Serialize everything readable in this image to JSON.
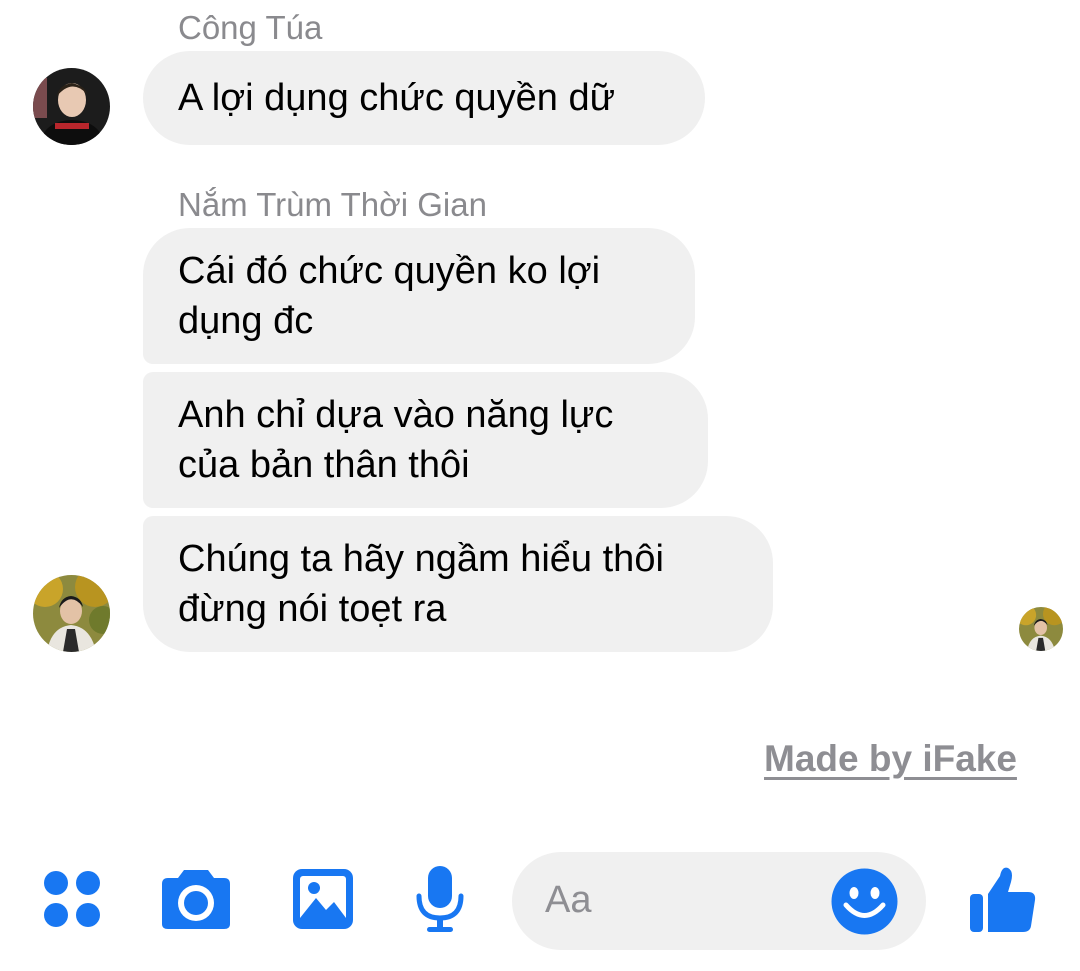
{
  "messages": [
    {
      "sender": "Công Túa",
      "bubbles": [
        "A lợi dụng chức quyền dữ"
      ]
    },
    {
      "sender": "Nắm Trùm Thời Gian",
      "bubbles": [
        "Cái đó chức quyền ko lợi\ndụng đc",
        "Anh chỉ dựa vào năng lực\ncủa bản thân thôi",
        "Chúng ta hãy ngầm hiểu thôi\nđừng nói toẹt ra"
      ]
    }
  ],
  "watermark": "Made by iFake",
  "composer": {
    "placeholder": "Aa",
    "icons": [
      "apps-icon",
      "camera-icon",
      "gallery-icon",
      "microphone-icon",
      "emoji-icon",
      "thumbs-up-icon"
    ],
    "accent_color": "#1877f2"
  }
}
